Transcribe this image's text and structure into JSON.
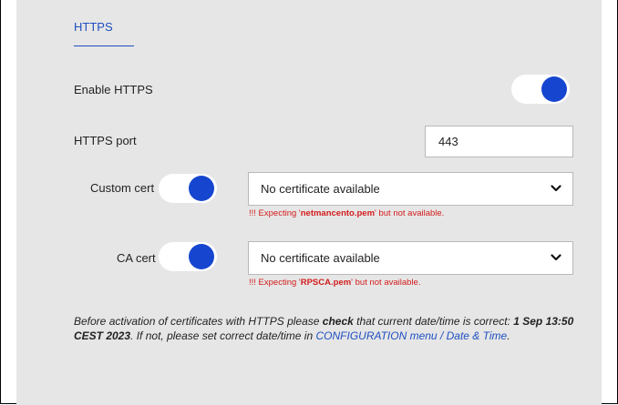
{
  "section": {
    "title": "HTTPS"
  },
  "https": {
    "enable_label": "Enable HTTPS",
    "port_label": "HTTPS port",
    "port_value": "443"
  },
  "custom_cert": {
    "label": "Custom cert",
    "selected": "No certificate available",
    "warn_prefix": "!!! Expecting '",
    "warn_file": "netmancento.pem",
    "warn_suffix": "' but not available."
  },
  "ca_cert": {
    "label": "CA cert",
    "selected": "No certificate available",
    "warn_prefix": "!!! Expecting '",
    "warn_file": "RPSCA.pem",
    "warn_suffix": "' but not available."
  },
  "note": {
    "part1": "Before activation of certificates with HTTPS please ",
    "emph1": "check",
    "part2": " that current date/time is correct: ",
    "datetime": "1 Sep 13:50 CEST 2023",
    "part3": ". If not, please set correct date/time in ",
    "link": "CONFIGURATION menu / Date & Time",
    "part4": "."
  },
  "colors": {
    "accent": "#1e4fc2",
    "toggle_knob": "#1646cf",
    "warning": "#d31c1c",
    "panel_bg": "#e6e6e6"
  },
  "icons": {
    "select_arrow": "chevron-down-icon"
  }
}
